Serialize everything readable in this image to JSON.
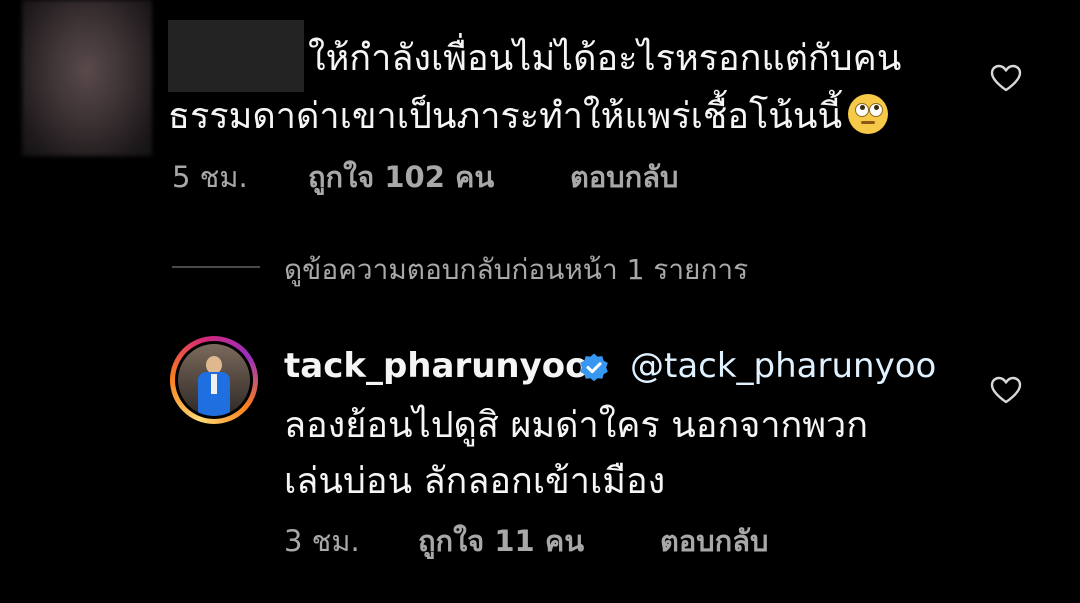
{
  "comment1": {
    "text_line1": "ให้กำลังเพื่อนไม่ได้อะไรหรอกแต่กับคน",
    "text_line2": "ธรรมดาด่าเขาเป็นภาระทำให้แพร่เชื้อโน้นนี้",
    "emoji": "face-with-rolling-eyes",
    "time": "5 ชม.",
    "likes": "ถูกใจ 102 คน",
    "reply": "ตอบกลับ"
  },
  "view_previous_replies": "ดูข้อความตอบกลับก่อนหน้า 1 รายการ",
  "comment2": {
    "username": "tack_pharunyoo",
    "mention": "@tack_pharunyoo",
    "text_line1": "ลองย้อนไปดูสิ ผมด่าใคร นอกจากพวก",
    "text_line2": "เล่นบ่อน ลักลอกเข้าเมือง",
    "time": "3 ชม.",
    "likes": "ถูกใจ 11 คน",
    "reply": "ตอบกลับ"
  },
  "colors": {
    "background": "#000000",
    "text": "#f5f5f5",
    "muted": "#a8a8a8",
    "verified": "#3897f0"
  }
}
